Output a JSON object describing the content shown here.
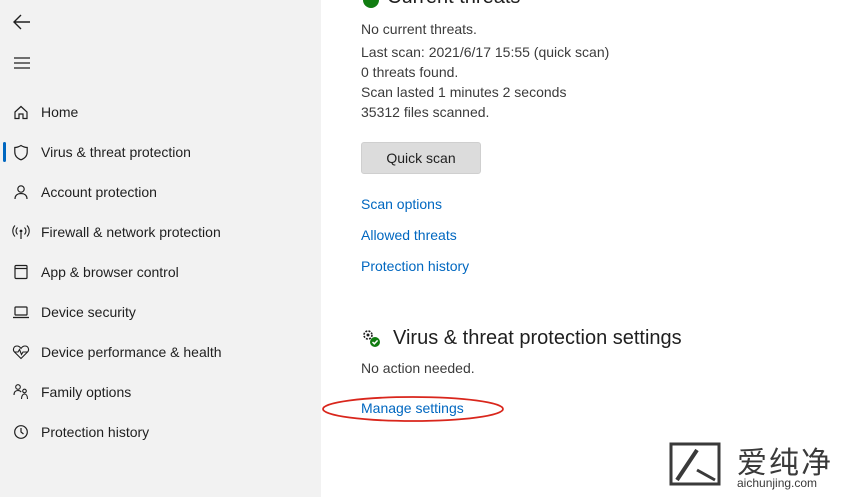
{
  "sidebar": {
    "back_icon": "back-arrow-icon",
    "menu_icon": "hamburger-menu-icon",
    "items": [
      {
        "label": "Home",
        "icon": "home-icon"
      },
      {
        "label": "Virus & threat protection",
        "icon": "shield-icon",
        "active": true
      },
      {
        "label": "Account protection",
        "icon": "person-icon"
      },
      {
        "label": "Firewall & network protection",
        "icon": "antenna-icon"
      },
      {
        "label": "App & browser control",
        "icon": "app-window-icon"
      },
      {
        "label": "Device security",
        "icon": "laptop-icon"
      },
      {
        "label": "Device performance & health",
        "icon": "heart-pulse-icon"
      },
      {
        "label": "Family options",
        "icon": "family-icon"
      },
      {
        "label": "Protection history",
        "icon": "history-icon"
      }
    ],
    "accent_color": "#0067c0"
  },
  "main": {
    "current_threats": {
      "title": "Current threats",
      "status": "No current threats.",
      "last_scan": "Last scan: 2021/6/17 15:55 (quick scan)",
      "threats_found": "0 threats found.",
      "scan_duration": "Scan lasted 1 minutes 2 seconds",
      "files_scanned": "35312 files scanned.",
      "quick_scan_button": "Quick scan",
      "links": {
        "scan_options": "Scan options",
        "allowed_threats": "Allowed threats",
        "protection_history": "Protection history"
      }
    },
    "settings": {
      "title": "Virus & threat protection settings",
      "status": "No action needed.",
      "manage_link": "Manage settings",
      "icon": "gear-check-icon"
    },
    "link_color": "#0067c0",
    "highlight_color": "#d9261c"
  },
  "watermark": {
    "cn_text": "爱纯净",
    "url": "aichunjing.com"
  }
}
